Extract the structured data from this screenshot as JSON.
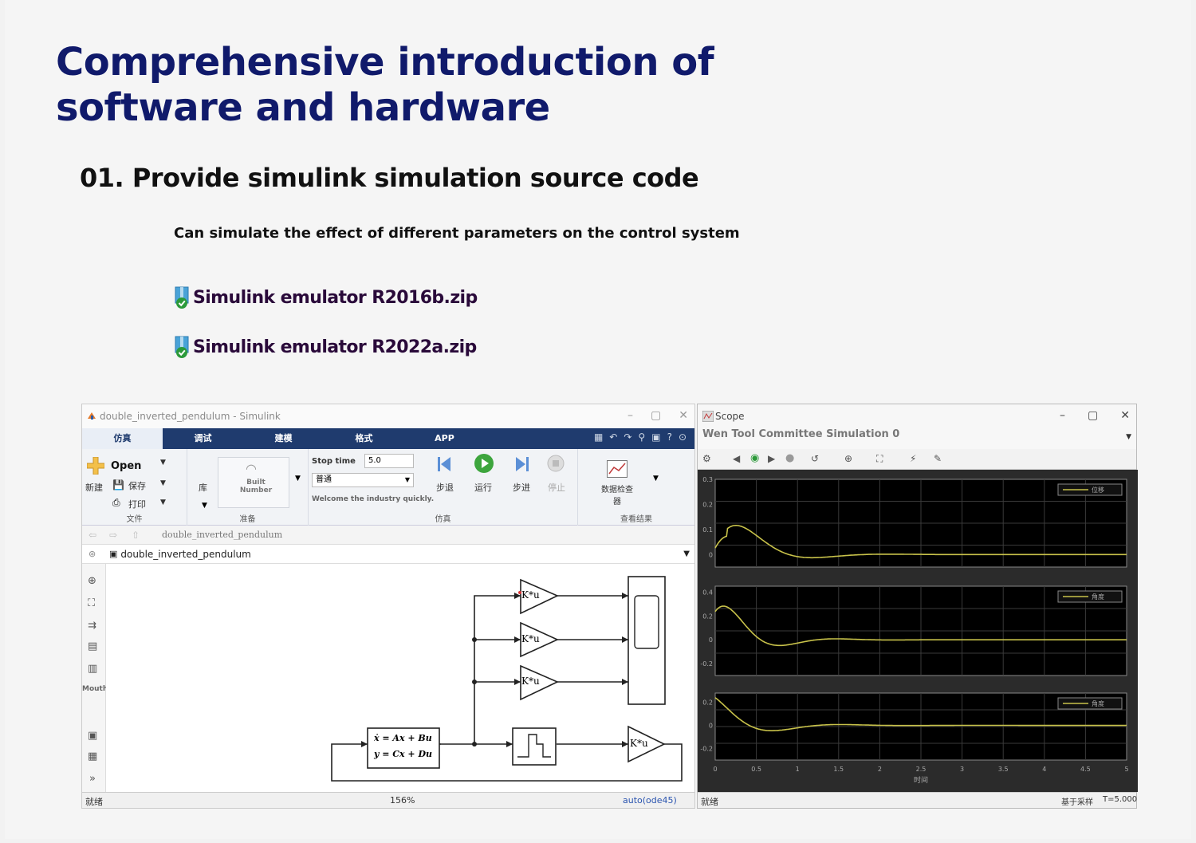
{
  "heading": {
    "title": "Comprehensive introduction of software and hardware",
    "section": "01. Provide simulink simulation source code",
    "subtitle": "Can simulate the effect of different parameters on the control system"
  },
  "files": [
    {
      "name": "Simulink emulator R2016b.zip"
    },
    {
      "name": "Simulink emulator R2022a.zip"
    }
  ],
  "simulink": {
    "window_title": "double_inverted_pendulum - Simulink",
    "tabs": [
      "仿真",
      "调试",
      "建模",
      "格式",
      "APP"
    ],
    "file_group": {
      "open": "Open",
      "new": "新建",
      "save": "保存",
      "print": "打印",
      "label": "文件"
    },
    "library": {
      "label": "库",
      "build": "Built Number",
      "group_label": "准备"
    },
    "sim_group": {
      "stop_time_label": "Stop time",
      "stop_time_value": "5.0",
      "mode": "普通",
      "hint": "Welcome the industry quickly.",
      "step_back": "步退",
      "run": "运行",
      "step_forward": "步进",
      "stop": "停止",
      "label": "仿真"
    },
    "review": {
      "inspector": "数据检查器",
      "label": "查看结果"
    },
    "breadcrumb": "double_inverted_pendulum",
    "model_name": "double_inverted_pendulum",
    "left_tool_label": "Mouth",
    "blocks": {
      "gain": "K*u",
      "state_space_1": "ẋ = Ax + Bu",
      "state_space_2": "y = Cx + Du"
    },
    "status": {
      "left": "就绪",
      "zoom": "156%",
      "solver": "auto(ode45)"
    }
  },
  "scope": {
    "window_title": "Scope",
    "subtitle": "Wen Tool Committee Simulation 0",
    "legends": [
      "位移",
      "角度",
      "角度"
    ],
    "x_axis_label": "时间",
    "x_ticks": [
      "0",
      "0.5",
      "1",
      "1.5",
      "2",
      "2.5",
      "3",
      "3.5",
      "4",
      "4.5",
      "5"
    ],
    "panels": [
      {
        "yticks": [
          "0.3",
          "0.2",
          "0.1",
          "0"
        ],
        "ymin": -0.05,
        "ymax": 0.3
      },
      {
        "yticks": [
          "0.4",
          "0.2",
          "0",
          "-0.2"
        ],
        "ymin": -0.3,
        "ymax": 0.45
      },
      {
        "yticks": [
          "0.2",
          "0",
          "-0.2"
        ],
        "ymin": -0.3,
        "ymax": 0.28
      }
    ],
    "status": {
      "left": "就绪",
      "right1": "基于采样",
      "right2": "T=5.000"
    },
    "line_color": "#c8c24a"
  }
}
